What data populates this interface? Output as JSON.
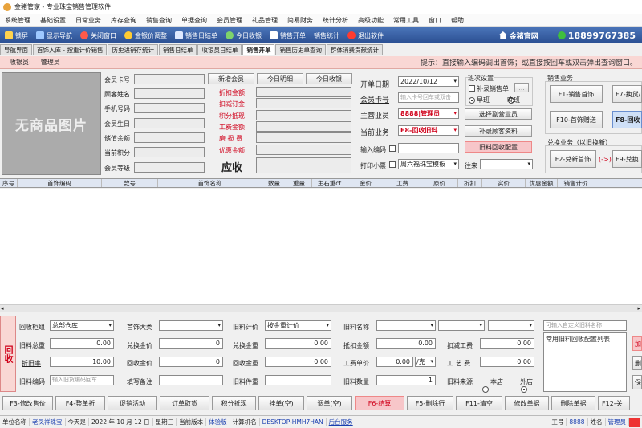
{
  "window": {
    "title": "金猪管家 - 专业珠宝销售管理软件"
  },
  "menu": [
    "系统管理",
    "基础设置",
    "日常业务",
    "库存查询",
    "销售查询",
    "单据查询",
    "会员管理",
    "礼品管理",
    "简易财务",
    "统计分析",
    "高级功能",
    "常用工具",
    "窗口",
    "帮助"
  ],
  "toolbar": {
    "items": [
      "锁屏",
      "显示导航",
      "关闭窗口",
      "金银价调整",
      "销售日结单",
      "今日收银",
      "销售开单",
      "销售统计",
      "退出软件"
    ],
    "brand": "金猪官网",
    "phone": "18899767385"
  },
  "tabs": [
    "导航界面",
    "首饰入库 - 按重计价销售",
    "历史进销存统计",
    "销售日结单",
    "收银员日结单",
    "销售开单",
    "销售历史单查询",
    "群体消费贡献统计"
  ],
  "operator": {
    "label": "收银员:",
    "name": "管理员",
    "hint": "提示：直接输入编码调出首饰；或直接按回车或双击弹出查询窗口。"
  },
  "photo": {
    "placeholder": "无商品图片"
  },
  "member_labels": [
    "会员卡号",
    "顾客姓名",
    "手机号码",
    "会员生日",
    "储值余额",
    "当前积分",
    "会员等级"
  ],
  "member_buttons": {
    "new": "新增会员",
    "today_detail": "今日明细",
    "today_cash": "今日收银"
  },
  "totals": {
    "labels": [
      "折扣金额",
      "扣减订金",
      "积分抵现",
      "工费金额",
      "磨 损 费",
      "优惠金额"
    ],
    "receivable": "应收"
  },
  "order": {
    "date_label": "开单日期",
    "date": "2022/10/12",
    "card_label": "会员卡号",
    "card_placeholder": "输入卡号回车或双击",
    "clerk_label": "主营业员",
    "clerk": "8888|管理员",
    "biz_label": "当前业务",
    "biz": "F8-回收旧料",
    "barcode_label": "输入编码",
    "print_label": "打印小票",
    "print_template": "周六福珠宝模板",
    "shift_title": "班次设置",
    "supplement": "补录销售单",
    "ellipsis": "...",
    "shift_morning": "早班",
    "shift_night": "晚班",
    "choose_clerk": "选择副营业员",
    "supp_customer": "补录顾客资料",
    "recycle_config": "旧料回收配置",
    "come_go": "往来"
  },
  "sales_biz": {
    "title": "销售业务",
    "buttons": [
      "F1-销售首饰",
      "F7-换货/...",
      "F10-首饰赠送",
      "F8-回收"
    ]
  },
  "exchange_biz": {
    "title": "兑换业务（以旧换新）",
    "buttons": [
      "F2-兑新首饰",
      "(->)",
      "F9-兑换..."
    ]
  },
  "grid": {
    "columns": [
      "序号",
      "首饰编码",
      "款号",
      "首饰名称",
      "数量",
      "重量",
      "主石重ct",
      "金价",
      "工费",
      "原价",
      "折扣",
      "实价",
      "优惠金额",
      "销售计价"
    ]
  },
  "recycle": {
    "side_label": "回收",
    "labels": {
      "cabinet": "回收柜组",
      "total_weight": "旧料总重",
      "old_rate": "折旧率",
      "code": "旧料编码",
      "category": "首饰大类",
      "exch_price": "兑换金价",
      "recycle_price": "回收金价",
      "remark": "填写备注",
      "price_mode": "旧料计价",
      "exch_weight": "兑换金重",
      "recycle_weight": "回收金重",
      "pieces": "旧料件重",
      "name": "旧料名称",
      "offset": "抵扣金额",
      "labor_unit": "工费单价",
      "qty": "旧料数量",
      "deduct_labor": "扣减工费",
      "craft_fee": "工 艺 费",
      "source": "旧料来源",
      "local": "本店",
      "other": "外店",
      "config_list": "常用旧料回收配置列表"
    },
    "values": {
      "cabinet": "总部仓库",
      "total_weight": "0.00",
      "old_rate": "10.00",
      "code_placeholder": "输入旧货编码回车",
      "exch_price": "0",
      "recycle_price": "0",
      "price_mode": "按金重计价",
      "exch_weight": "0.00",
      "recycle_weight": "0.00",
      "offset": "0.00",
      "labor_unit": "0.00",
      "labor_unit_sel": "/克",
      "qty": "1",
      "deduct_labor": "0.00",
      "craft_fee": "0.00",
      "custom_placeholder": "可输入自定义旧料名称"
    },
    "side_buttons": [
      "加",
      "删",
      "保"
    ]
  },
  "bottom_buttons": [
    "F3-修改售价",
    "F4-整单折",
    "促销活动",
    "订单取货",
    "积分抵现",
    "挂单(空)",
    "调单(空)",
    "F6-结算",
    "F5-删除行",
    "F11-清空",
    "修改单据",
    "删除单据",
    "F12-关"
  ],
  "status": {
    "unit_label": "单位名称",
    "unit": "老凤祥珠宝",
    "today_label": "今天是",
    "today": "2022 年 10 月 12 日",
    "weekday": "星期三",
    "ver_label": "当前版本",
    "ver": "体验版",
    "host_label": "计算机名",
    "host": "DESKTOP-HMH7HAN",
    "backend": "后台服务",
    "emp_label": "工号",
    "emp": "8888",
    "name_label": "姓名",
    "name": "管理员"
  }
}
